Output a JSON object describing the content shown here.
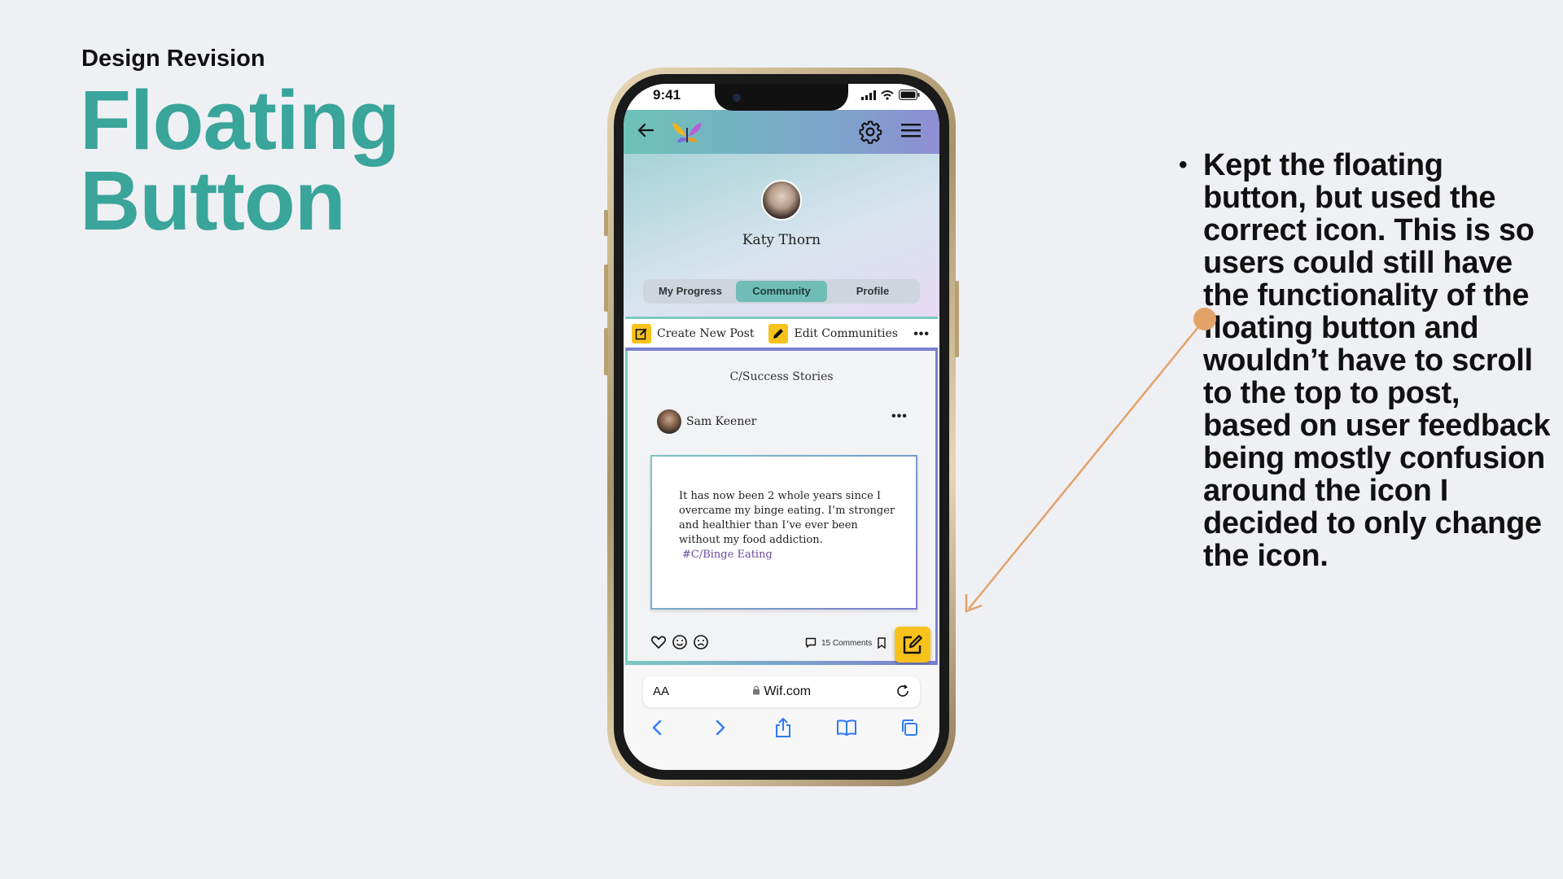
{
  "slide": {
    "subtitle": "Design Revision",
    "title": "Floating\nButton",
    "bullet": "Kept the floating button, but used the correct icon. This is so users could still have the functionality of the floating button and wouldn’t have to scroll to the top to post, based on user feedback being mostly confusion around the icon I decided to only change the icon.",
    "accent_color": "#3aa59a",
    "arrow_color": "#e3a268"
  },
  "phone": {
    "status": {
      "time": "9:41"
    },
    "header": {
      "back_icon": "back-arrow-icon",
      "logo": "wif-butterfly-logo",
      "settings_icon": "gear-icon",
      "menu_icon": "hamburger-menu-icon"
    },
    "profile": {
      "name": "Katy Thorn",
      "tabs": [
        {
          "label": "My Progress",
          "active": false
        },
        {
          "label": "Community",
          "active": true
        },
        {
          "label": "Profile",
          "active": false
        }
      ]
    },
    "actions": {
      "create_post": "Create New Post",
      "edit_communities": "Edit Communities",
      "more": "•••"
    },
    "feed": {
      "community": "C/Success Stories",
      "post": {
        "author": "Sam Keener",
        "more": "•••",
        "body": "It has now been 2 whole years since I overcame my binge eating. I’m stronger and healthier than I’ve ever been without my food addiction.",
        "tag": "#C/Binge Eating",
        "comments": "15 Comments"
      }
    },
    "browser": {
      "aa": "AA",
      "url": "Wif.com"
    }
  }
}
